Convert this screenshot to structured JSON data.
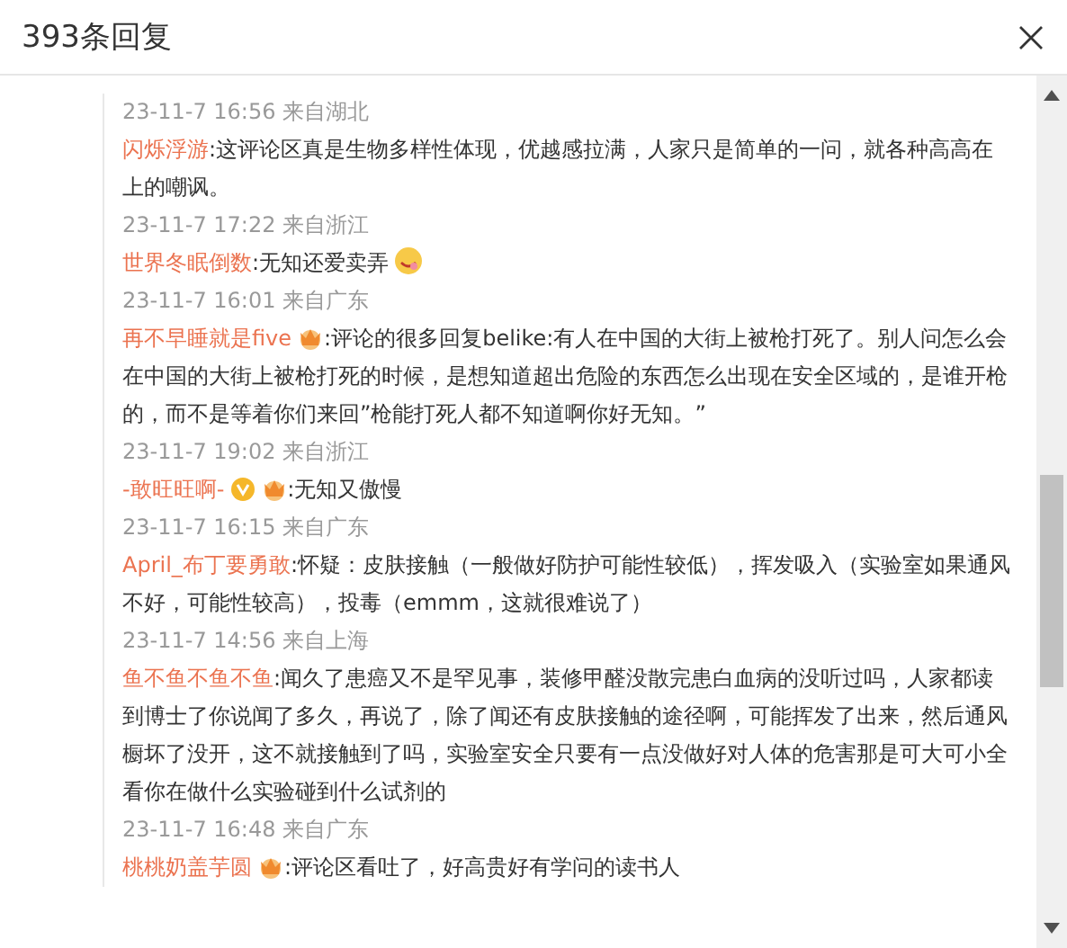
{
  "dialog": {
    "title": "393条回复"
  },
  "top_time": "23-11-7 16:56 来自湖北",
  "comments": [
    {
      "name": "闪烁浮游",
      "text": ":这评论区真是生物多样性体现，优越感拉满，人家只是简单的一问，就各种高高在上的嘲讽。",
      "time": "23-11-7 17:22 来自浙江"
    },
    {
      "name": "世界冬眠倒数",
      "text": ":无知还爱卖弄",
      "trailing_icon": {
        "kind": "emoji"
      },
      "time": "23-11-7 16:01 来自广东"
    },
    {
      "name": "再不早睡就是five",
      "badges": [
        {
          "kind": "crown"
        }
      ],
      "text": ":评论的很多回复belike:有人在中国的大街上被枪打死了。别人问怎么会在中国的大街上被枪打死的时候，是想知道超出危险的东西怎么出现在安全区域的，是谁开枪的，而不是等着你们来回”枪能打死人都不知道啊你好无知。”",
      "time": "23-11-7 19:02 来自浙江"
    },
    {
      "name": "-敢旺旺啊-",
      "badges": [
        {
          "kind": "verified"
        },
        {
          "kind": "crown"
        }
      ],
      "text": ":无知又傲慢",
      "time": "23-11-7 16:15 来自广东"
    },
    {
      "name": "April_布丁要勇敢",
      "text": ":怀疑：皮肤接触（一般做好防护可能性较低），挥发吸入（实验室如果通风不好，可能性较高），投毒（emmm，这就很难说了）",
      "time": "23-11-7 14:56 来自上海"
    },
    {
      "name": "鱼不鱼不鱼不鱼",
      "text": ":闻久了患癌又不是罕见事，装修甲醛没散完患白血病的没听过吗，人家都读到博士了你说闻了多久，再说了，除了闻还有皮肤接触的途径啊，可能挥发了出来，然后通风橱坏了没开，这不就接触到了吗，实验室安全只要有一点没做好对人体的危害那是可大可小全看你在做什么实验碰到什么试剂的",
      "time": "23-11-7 16:48 来自广东"
    },
    {
      "name": "桃桃奶盖芋圆",
      "badges": [
        {
          "kind": "crown"
        }
      ],
      "text": ":评论区看吐了，好高贵好有学问的读书人"
    }
  ]
}
